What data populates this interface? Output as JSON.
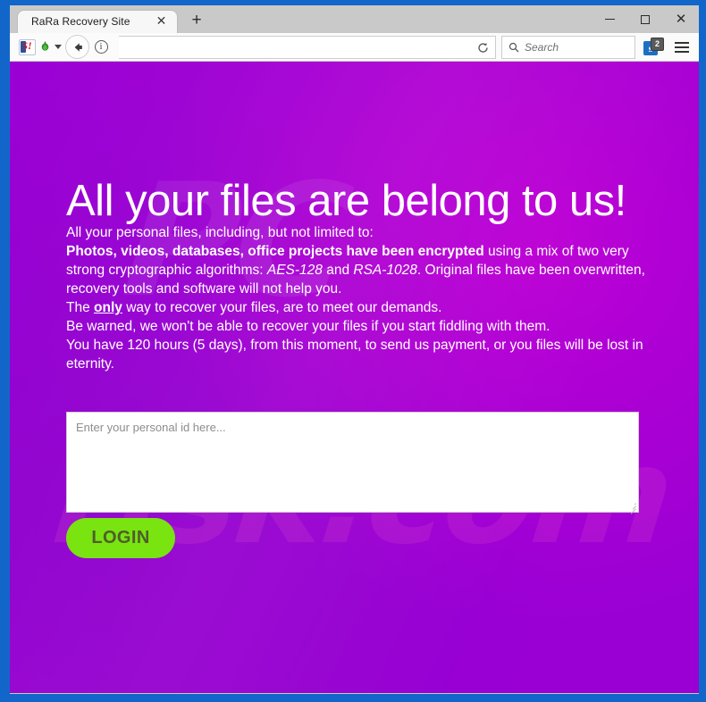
{
  "browser": {
    "tab": {
      "title": "RaRa Recovery Site",
      "close_label": "✕"
    },
    "new_tab_label": "+",
    "window_controls": {
      "minimize": "–",
      "maximize": "□",
      "close": "✕"
    },
    "toolbar": {
      "yahoo_label": "S!",
      "url_value": "",
      "url_placeholder": "",
      "reload_label": "↻",
      "search_placeholder": "Search",
      "skype_label": "s",
      "skype_badge": "2"
    }
  },
  "page": {
    "watermark_top": "PC",
    "watermark_bottom": "risk.com",
    "headline": "All your files are belong to us!",
    "intro": "All your personal files, including, but not limited to:",
    "encrypted_bold": "Photos, videos, databases, office projects have been encrypted",
    "encrypted_rest_1": " using a mix of two very strong cryptographic algorithms: ",
    "algo_1": "AES-128",
    "encrypted_rest_2": " and ",
    "algo_2": "RSA-1028",
    "encrypted_rest_3": ". Original files have been overwritten, recovery tools and software will not help you.",
    "only_pre": "The ",
    "only_word": "only",
    "only_post": " way to recover your files, are to meet our demands.",
    "warning": "Be warned, we won't be able to recover your files if you start fiddling with them.",
    "deadline": "You have 120 hours (5 days), from this moment, to send us payment, or you files will be lost in eternity.",
    "id_input_placeholder": "Enter your personal id here...",
    "id_input_value": "",
    "login_label": "LOGIN"
  },
  "colors": {
    "page_background": "#9900d6",
    "window_border": "#1266c9",
    "login_button": "#79e410",
    "login_button_text": "#4f5e2c",
    "tabstrip": "#c9c9c9",
    "toolbar": "#fbfbfb"
  }
}
